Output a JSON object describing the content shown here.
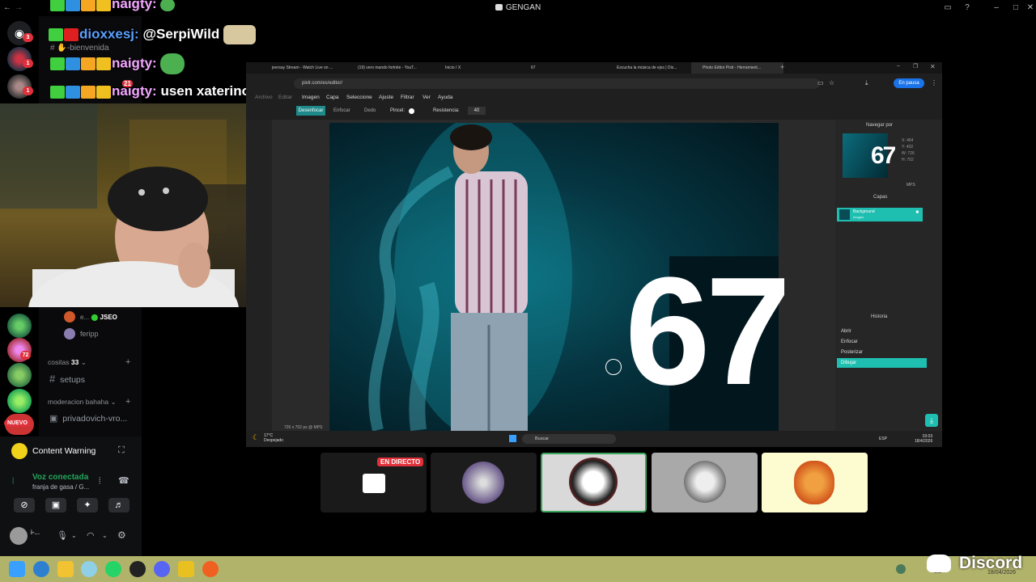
{
  "window": {
    "title": "GENGAN",
    "back_glyph": "←",
    "fwd_glyph": "→"
  },
  "chat": {
    "line1_user": "naigty:",
    "line2_user": "dioxxesj:",
    "line2_text": "@SerpiWild",
    "line3_user": "naigty:",
    "line4_user": "naigty:",
    "line4_text": "usen xaterino",
    "line4_badge_count": "21"
  },
  "discord": {
    "bienvenida": "bienvenida",
    "member1": "e...",
    "member1_tag": "JSEO",
    "member2": "feripp",
    "category1": "cositas",
    "category1_emoji": "33",
    "channel_setups": "setups",
    "category2": "moderacion bahaha",
    "channel_private": "privadovich-vro...",
    "new_badge": "NUEVO",
    "server_badges": [
      "3",
      "1",
      "1",
      "72"
    ],
    "content_warning": "Content Warning",
    "voice_status": "Voz conectada",
    "voice_channel": "franja de gasa / G...",
    "username": "i-..."
  },
  "browser": {
    "tabs": [
      "jeersay Stream - Watch Live on ...",
      "(19) vero mando fortnite - YouT...",
      "Inicio / X",
      "67",
      "Escucha la música de ejxs | Dis...",
      "Photo Editor Pixlr - Herramient..."
    ],
    "url": "pixlr.com/es/editor/",
    "pause_label": "En pausa",
    "menu": [
      "Archivo",
      "Editar",
      "Imagen",
      "Capa",
      "Seleccione",
      "Ajuste",
      "Filtrar",
      "Ver",
      "Ayuda"
    ],
    "tool_options": {
      "mode": "Desenfocar",
      "opt2": "Enfocar",
      "opt3": "Dedo",
      "brush": "Pincel:",
      "strength_label": "Resistencia:",
      "strength": "40"
    },
    "navigator": {
      "title": "Navegar por",
      "x": "X: 464",
      "y": "Y: 402",
      "w": "W: 726",
      "h": "H: 702",
      "zoom": "MPS"
    },
    "layers": {
      "title": "Capas",
      "layer_name": "Background",
      "layer_type": "Imagen"
    },
    "history": {
      "title": "Historia",
      "items": [
        "Abrir",
        "Enfocar",
        "Posterizar",
        "Dibujar"
      ]
    },
    "status": "726 x 702 px @ MPS",
    "image_text": "67",
    "weather": {
      "temp": "17°C",
      "desc": "Despejado"
    },
    "search": "Buscar",
    "lang": "ESP",
    "clock": {
      "time": "03:03",
      "date": "18/4/2026"
    }
  },
  "tiles": {
    "live_label": "EN DIRECTO"
  },
  "taskbar": {
    "brand": "Discord",
    "lang": "ES",
    "time": "03:03",
    "date": "18/04/2026"
  }
}
